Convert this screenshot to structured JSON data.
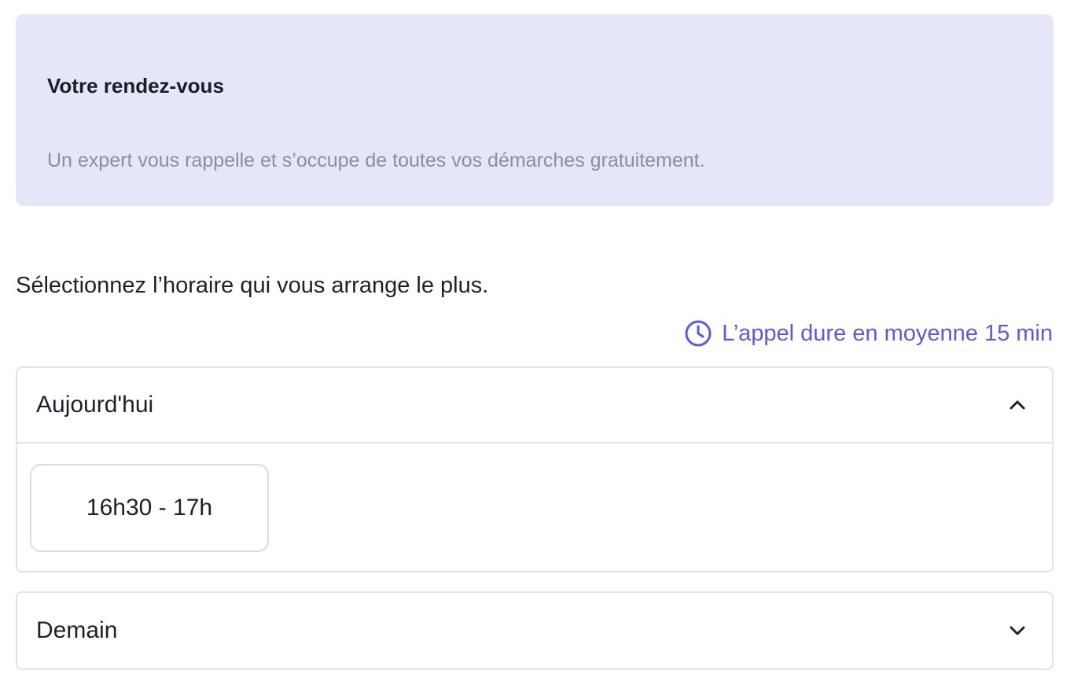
{
  "info": {
    "title": "Votre rendez-vous",
    "subtitle": "Un expert vous rappelle et s’occupe de toutes vos démarches gratuitement."
  },
  "prompt": "Sélectionnez l’horaire qui vous arrange le plus.",
  "duration": {
    "icon": "clock-icon",
    "text": "L’appel dure en moyenne 15 min",
    "color": "#5b58e6"
  },
  "days": [
    {
      "label": "Aujourd'hui",
      "expanded": true,
      "chevron": "chevron-up-icon",
      "slots": [
        "16h30 - 17h"
      ]
    },
    {
      "label": "Demain",
      "expanded": false,
      "chevron": "chevron-down-icon",
      "slots": []
    }
  ],
  "colors": {
    "card_background": "#e5e6f8",
    "accent": "#5b58e6",
    "muted_text": "#8d8ea6",
    "border": "#e2e2e8"
  }
}
